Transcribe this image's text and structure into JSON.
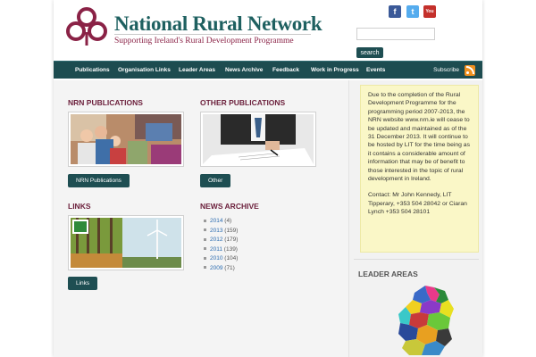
{
  "header": {
    "title": "National Rural Network",
    "tagline": "Supporting Ireland's Rural Development Programme",
    "social": {
      "facebook": "f",
      "twitter": "t",
      "youtube": "You Tube"
    },
    "search_button": "search"
  },
  "nav": {
    "items": [
      "Publications",
      "Organisation Links",
      "Leader Areas",
      "News Archive",
      "Feedback",
      "Work in Progress",
      "Events"
    ],
    "subscribe": "Subscribe"
  },
  "sections": {
    "nrn_publications": {
      "title": "NRN PUBLICATIONS",
      "button": "NRN Publications"
    },
    "other_publications": {
      "title": "OTHER PUBLICATIONS",
      "button": "Other"
    },
    "links": {
      "title": "LINKS",
      "button": "Links"
    },
    "news_archive": {
      "title": "NEWS ARCHIVE",
      "years": [
        {
          "year": "2014",
          "count": "(4)"
        },
        {
          "year": "2013",
          "count": "(159)"
        },
        {
          "year": "2012",
          "count": "(179)"
        },
        {
          "year": "2011",
          "count": "(139)"
        },
        {
          "year": "2010",
          "count": "(104)"
        },
        {
          "year": "2009",
          "count": "(71)"
        }
      ]
    }
  },
  "sidebar": {
    "notice_p1": "Due to the completion of the Rural Development Programme for the programming period 2007-2013, the NRN website www.nrn.ie will cease to be updated and maintained as of the 31 December 2013.  It will continue to be hosted by LIT for the time being as it contains a considerable amount of information that may be of benefit to those interested in the topic of rural development in Ireland.",
    "notice_p2": "Contact: Mr John Kennedy, LIT Tipperary, +353 504 28042 or Ciaran Lynch +353 504 28101",
    "leader_title": "LEADER AREAS"
  },
  "colors": {
    "brand_teal": "#1e6060",
    "accent_maroon": "#6b1f3b",
    "nav_bg": "#1d4c50",
    "notice_bg": "#faf7c7"
  }
}
